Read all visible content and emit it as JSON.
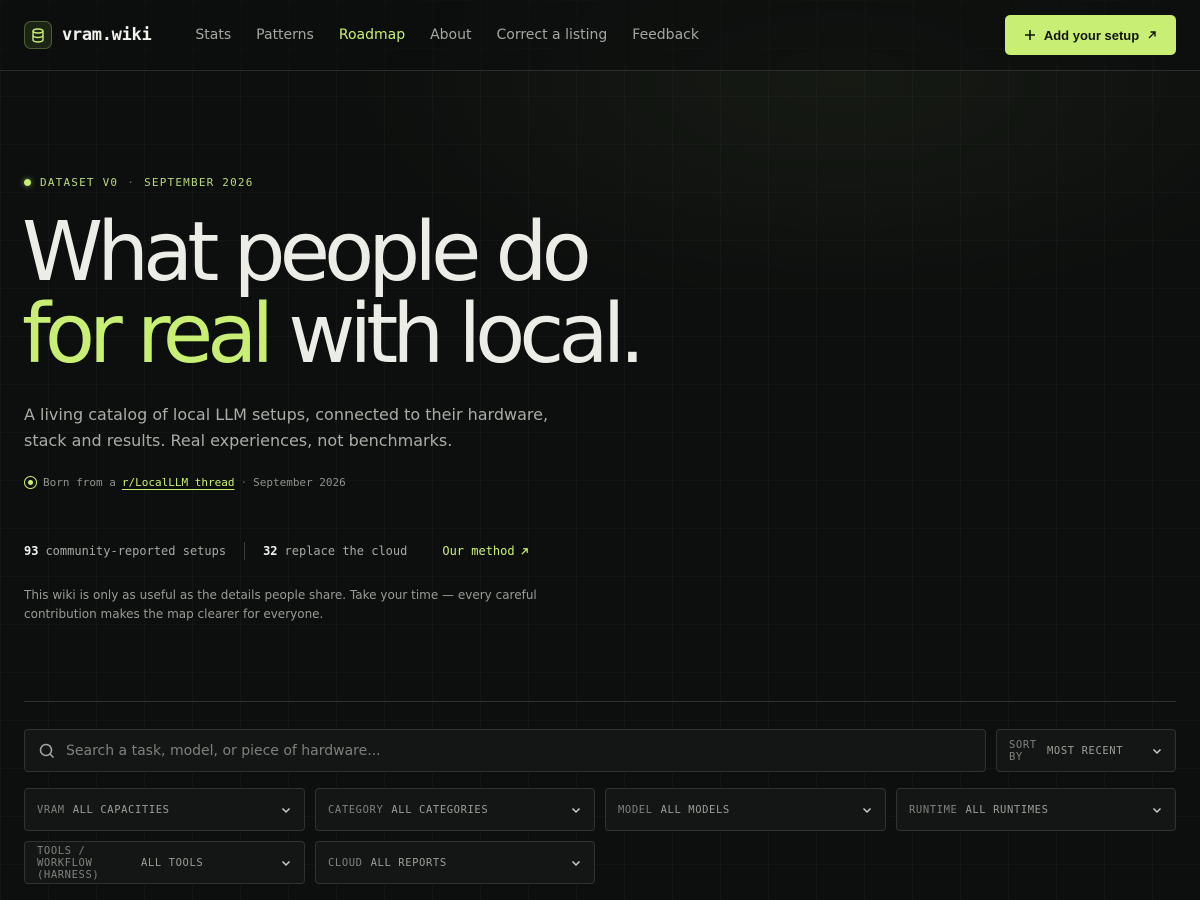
{
  "header": {
    "logo_text": "vram.wiki",
    "nav": [
      {
        "label": "Stats"
      },
      {
        "label": "Patterns"
      },
      {
        "label": "Roadmap",
        "active": true
      },
      {
        "label": "About"
      },
      {
        "label": "Correct a listing"
      },
      {
        "label": "Feedback"
      }
    ],
    "cta_label": "Add your setup"
  },
  "hero": {
    "eyebrow_left": "DATASET V0",
    "eyebrow_sep": "·",
    "eyebrow_right": "SEPTEMBER 2026",
    "title_line1": "What people do",
    "title_accent": "for real",
    "title_rest": "with local.",
    "lede": "A living catalog of local LLM setups, connected to their hardware, stack and results. Real experiences, not benchmarks.",
    "born_prefix": "Born from a",
    "born_link": "r/LocalLLM thread",
    "born_sep": "·",
    "born_date": "September 2026"
  },
  "stats": {
    "setups_count": "93",
    "setups_label": "community-reported setups",
    "replace_count": "32",
    "replace_label": "replace the cloud",
    "method_label": "Our method"
  },
  "note": "This wiki is only as useful as the details people share. Take your time — every careful contribution makes the map clearer for everyone.",
  "search": {
    "placeholder": "Search a task, model, or piece of hardware..."
  },
  "sort": {
    "label": "SORT BY",
    "value": "MOST RECENT"
  },
  "filters": [
    {
      "label": "VRAM",
      "value": "ALL CAPACITIES"
    },
    {
      "label": "CATEGORY",
      "value": "ALL CATEGORIES"
    },
    {
      "label": "MODEL",
      "value": "ALL MODELS"
    },
    {
      "label": "RUNTIME",
      "value": "ALL RUNTIMES"
    },
    {
      "label": "TOOLS / WORKFLOW (HARNESS)",
      "value": "ALL TOOLS"
    },
    {
      "label": "CLOUD",
      "value": "ALL REPORTS"
    }
  ],
  "colors": {
    "accent": "#c8ef74",
    "background": "#0d0f0e"
  }
}
